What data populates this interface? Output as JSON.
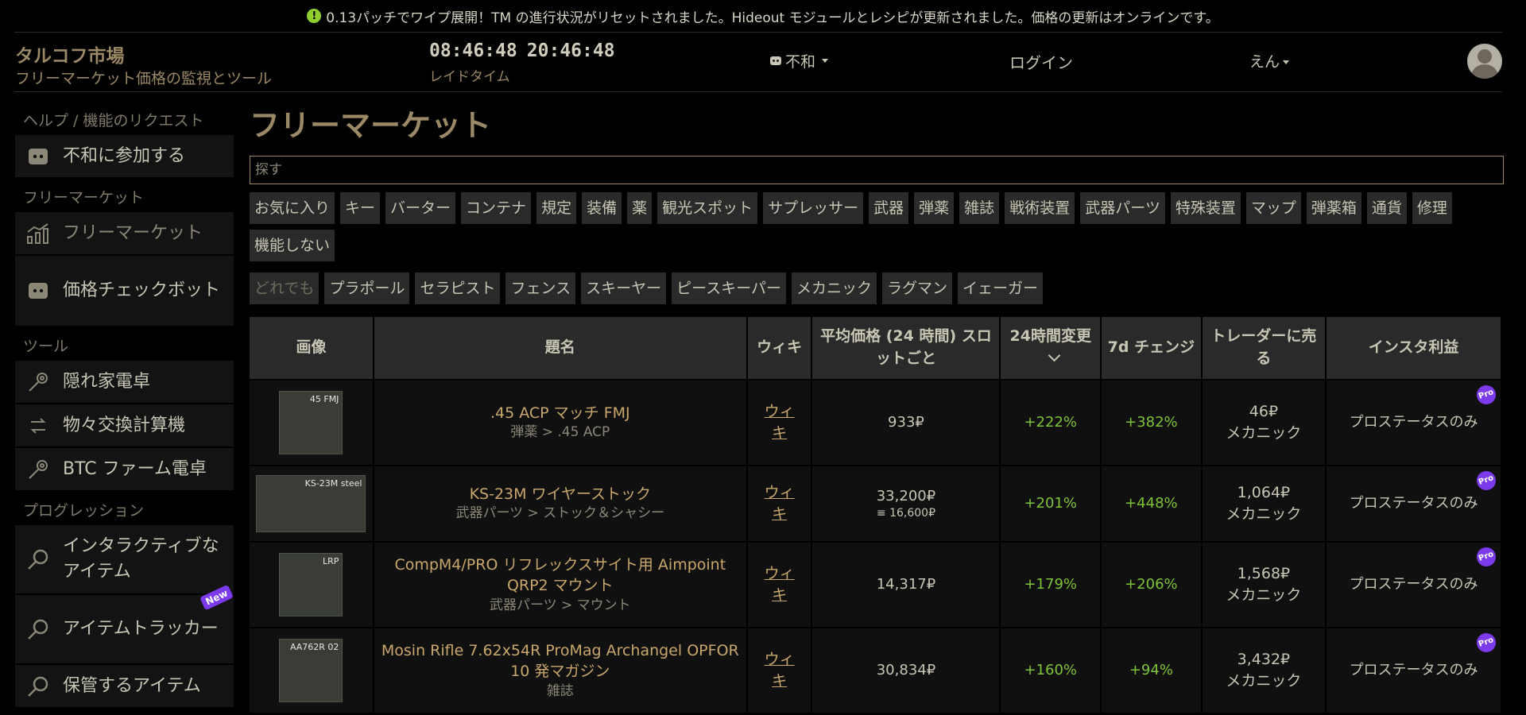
{
  "notice": {
    "text": "0.13パッチでワイプ展開！TM の進行状況がリセットされました。Hideout モジュールとレシピが更新されました。価格の更新はオンラインです。"
  },
  "header": {
    "title": "タルコフ市場",
    "subtitle": "フリーマーケット価格の監視とツール",
    "time1": "08:46:48",
    "time2": "20:46:48",
    "time_label": "レイドタイム",
    "discord_label": "不和",
    "login_label": "ログイン",
    "lang_label": "えん"
  },
  "sidebar": {
    "section1": "ヘルプ / 機能のリクエスト",
    "join_discord": "不和に参加する",
    "section2": "フリーマーケット",
    "flea_market": "フリーマーケット",
    "price_bot": "価格チェックボット",
    "section3": "ツール",
    "hideout": "隠れ家電卓",
    "barter_calc": "物々交換計算機",
    "btc_farm": "BTC ファーム電卓",
    "section4": "プログレッション",
    "interactive_items": "インタラクティブなアイテム",
    "item_tracker": "アイテムトラッカー",
    "new_badge": "New",
    "stored_items": "保管するアイテム"
  },
  "main": {
    "title": "フリーマーケット",
    "search_placeholder": "探す",
    "categories": [
      "お気に入り",
      "キー",
      "バーター",
      "コンテナ",
      "規定",
      "装備",
      "薬",
      "観光スポット",
      "サプレッサー",
      "武器",
      "弾薬",
      "雑誌",
      "戦術装置",
      "武器パーツ",
      "特殊装置",
      "マップ",
      "弾薬箱",
      "通貨",
      "修理",
      "機能しない"
    ],
    "traders": [
      "どれでも",
      "プラポール",
      "セラピスト",
      "フェンス",
      "スキーヤー",
      "ピースキーパー",
      "メカニック",
      "ラグマン",
      "イェーガー"
    ]
  },
  "table": {
    "headers": {
      "image": "画像",
      "name": "題名",
      "wiki": "ウィキ",
      "avg_price": "平均価格 (24 時間) スロットごと",
      "change24": "24時間変更",
      "change7d": "7d チェンジ",
      "sell_trader": "トレーダーに売る",
      "insta_profit": "インスタ利益"
    },
    "rows": [
      {
        "thumb_tag": "45 FMJ",
        "name": ".45 ACP マッチ FMJ",
        "category": "弾薬 > .45 ACP",
        "wiki": "ウィキ",
        "price": "933₽",
        "subprice": "",
        "change24": "+222%",
        "change7d": "+382%",
        "trader_price": "46₽",
        "trader": "メカニック",
        "profit": "プロステータスのみ",
        "pro": "Pro"
      },
      {
        "thumb_tag": "KS-23M steel",
        "name": "KS-23M ワイヤーストック",
        "category": "武器パーツ > ストック＆シャシー",
        "wiki": "ウィキ",
        "price": "33,200₽",
        "subprice": "≡ 16,600₽",
        "change24": "+201%",
        "change7d": "+448%",
        "trader_price": "1,064₽",
        "trader": "メカニック",
        "profit": "プロステータスのみ",
        "pro": "Pro"
      },
      {
        "thumb_tag": "LRP",
        "name": "CompM4/PRO リフレックスサイト用 Aimpoint QRP2 マウント",
        "category": "武器パーツ > マウント",
        "wiki": "ウィキ",
        "price": "14,317₽",
        "subprice": "",
        "change24": "+179%",
        "change7d": "+206%",
        "trader_price": "1,568₽",
        "trader": "メカニック",
        "profit": "プロステータスのみ",
        "pro": "Pro"
      },
      {
        "thumb_tag": "AA762R 02",
        "name": "Mosin Rifle 7.62x54R ProMag Archangel OPFOR 10 発マガジン",
        "category": "雑誌",
        "wiki": "ウィキ",
        "price": "30,834₽",
        "subprice": "",
        "change24": "+160%",
        "change7d": "+94%",
        "trader_price": "3,432₽",
        "trader": "メカニック",
        "profit": "プロステータスのみ",
        "pro": "Pro"
      }
    ]
  }
}
